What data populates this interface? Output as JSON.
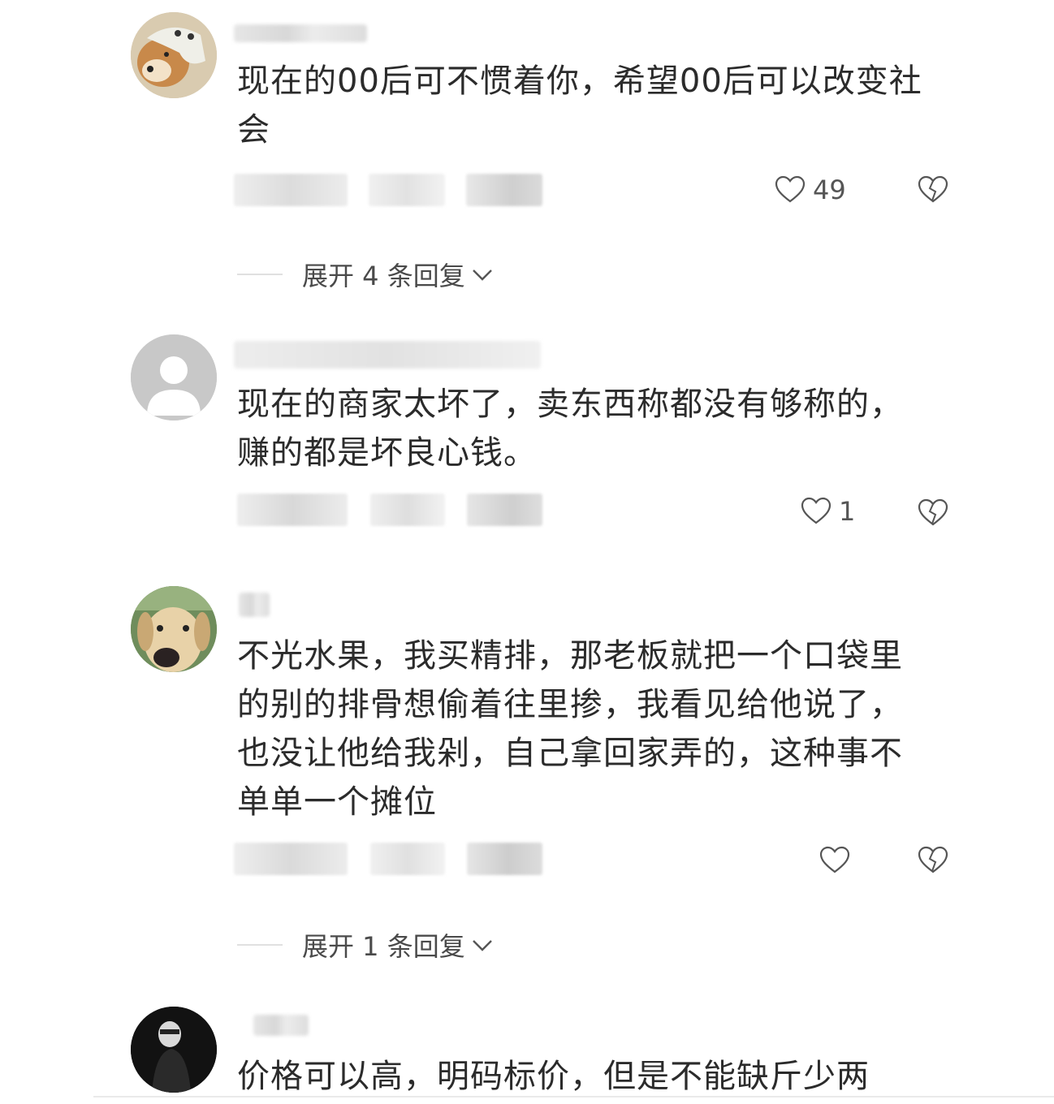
{
  "comments": [
    {
      "text": "现在的00后可不惯着你，希望00后可以改变社会",
      "likes": "49",
      "expand_label": "展开 4 条回复",
      "avatar": "shiba-dog-avatar"
    },
    {
      "text": "现在的商家太坏了，卖东西称都没有够称的，赚的都是坏良心钱。",
      "likes": "1",
      "avatar": "default-user-avatar"
    },
    {
      "text": "不光水果，我买精排，那老板就把一个口袋里的别的排骨想偷着往里掺，我看见给他说了，也没让他给我剁，自己拿回家弄的，这种事不单单一个摊位",
      "likes": "",
      "expand_label": "展开 1 条回复",
      "avatar": "dog-avatar"
    },
    {
      "text": "价格可以高，明码标价，但是不能缺斤少两",
      "avatar": "dark-portrait-avatar"
    }
  ]
}
